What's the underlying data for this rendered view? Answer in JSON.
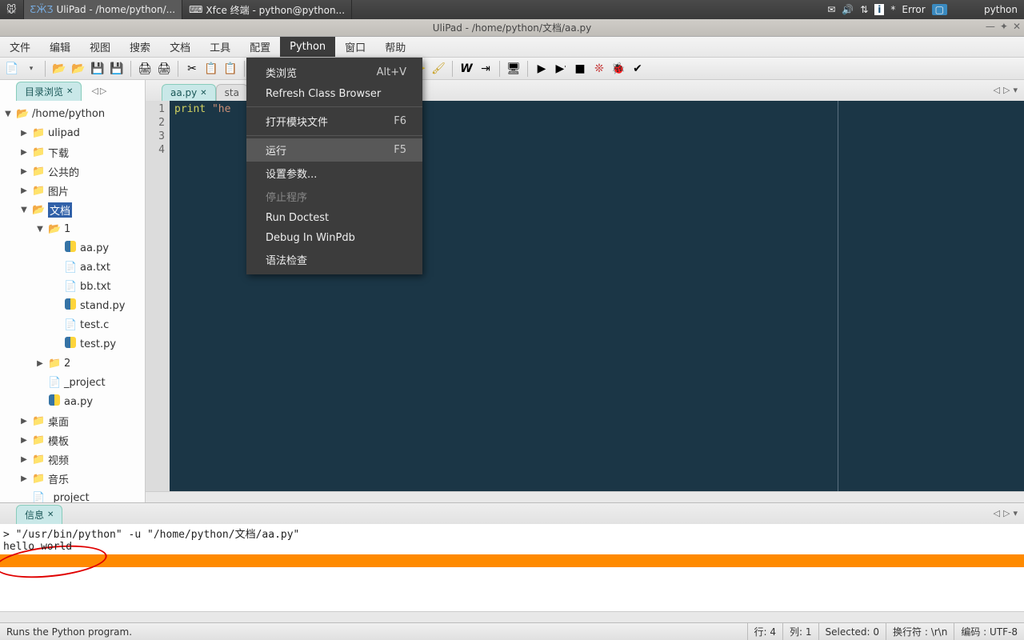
{
  "taskbar": {
    "items": [
      {
        "label": "UliPad - /home/python/..."
      },
      {
        "label": "Xfce 终端 - python@python..."
      }
    ],
    "tray": {
      "error_label": "Error",
      "user": "python"
    }
  },
  "window": {
    "title": "UliPad - /home/python/文档/aa.py"
  },
  "menubar": [
    "文件",
    "编辑",
    "视图",
    "搜索",
    "文档",
    "工具",
    "配置",
    "Python",
    "窗口",
    "帮助"
  ],
  "menubar_active_index": 7,
  "dropdown": {
    "items": [
      {
        "label": "类浏览",
        "shortcut": "Alt+V"
      },
      {
        "label": "Refresh Class Browser",
        "shortcut": ""
      },
      {
        "sep": true
      },
      {
        "label": "打开模块文件",
        "shortcut": "F6"
      },
      {
        "sep": true
      },
      {
        "label": "运行",
        "shortcut": "F5",
        "hover": true
      },
      {
        "label": "设置参数...",
        "shortcut": ""
      },
      {
        "label": "停止程序",
        "shortcut": "",
        "disabled": true
      },
      {
        "label": "Run Doctest",
        "shortcut": ""
      },
      {
        "label": "Debug In WinPdb",
        "shortcut": ""
      },
      {
        "label": "语法检查",
        "shortcut": ""
      }
    ]
  },
  "sidebar": {
    "tab_label": "目录浏览",
    "tree": [
      {
        "d": 0,
        "tw": "▼",
        "icon": "folder-open",
        "label": "/home/python"
      },
      {
        "d": 1,
        "tw": "▶",
        "icon": "folder",
        "label": "ulipad"
      },
      {
        "d": 1,
        "tw": "▶",
        "icon": "folder",
        "label": "下载"
      },
      {
        "d": 1,
        "tw": "▶",
        "icon": "folder",
        "label": "公共的"
      },
      {
        "d": 1,
        "tw": "▶",
        "icon": "folder",
        "label": "图片"
      },
      {
        "d": 1,
        "tw": "▼",
        "icon": "folder-open",
        "label": "文档",
        "selected": true
      },
      {
        "d": 2,
        "tw": "▼",
        "icon": "folder-open",
        "label": "1"
      },
      {
        "d": 3,
        "tw": "",
        "icon": "py",
        "label": "aa.py"
      },
      {
        "d": 3,
        "tw": "",
        "icon": "txt",
        "label": "aa.txt"
      },
      {
        "d": 3,
        "tw": "",
        "icon": "txt",
        "label": "bb.txt"
      },
      {
        "d": 3,
        "tw": "",
        "icon": "py",
        "label": "stand.py"
      },
      {
        "d": 3,
        "tw": "",
        "icon": "txt",
        "label": "test.c"
      },
      {
        "d": 3,
        "tw": "",
        "icon": "py",
        "label": "test.py"
      },
      {
        "d": 2,
        "tw": "▶",
        "icon": "folder",
        "label": "2"
      },
      {
        "d": 2,
        "tw": "",
        "icon": "txt",
        "label": "_project"
      },
      {
        "d": 2,
        "tw": "",
        "icon": "py",
        "label": "aa.py"
      },
      {
        "d": 1,
        "tw": "▶",
        "icon": "folder",
        "label": "桌面"
      },
      {
        "d": 1,
        "tw": "▶",
        "icon": "folder",
        "label": "模板"
      },
      {
        "d": 1,
        "tw": "▶",
        "icon": "folder",
        "label": "视频"
      },
      {
        "d": 1,
        "tw": "▶",
        "icon": "folder",
        "label": "音乐"
      },
      {
        "d": 1,
        "tw": "",
        "icon": "txt",
        "label": "_project"
      }
    ]
  },
  "editor": {
    "tabs": [
      {
        "label": "aa.py",
        "active": true
      },
      {
        "label": "sta",
        "active": false
      }
    ],
    "gutter": [
      "1",
      "2",
      "3",
      "4"
    ],
    "code_kw": "print",
    "code_str": "\"he",
    "visible_code": "print \"he"
  },
  "bottom": {
    "tab_label": "信息",
    "lines": [
      "> \"/usr/bin/python\" -u \"/home/python/文档/aa.py\"",
      "hello world"
    ]
  },
  "statusbar": {
    "hint": "Runs the Python program.",
    "row": "行: 4",
    "col": "列: 1",
    "sel": "Selected: 0",
    "eol": "换行符 : \\r\\n",
    "enc": "编码 : UTF-8"
  }
}
